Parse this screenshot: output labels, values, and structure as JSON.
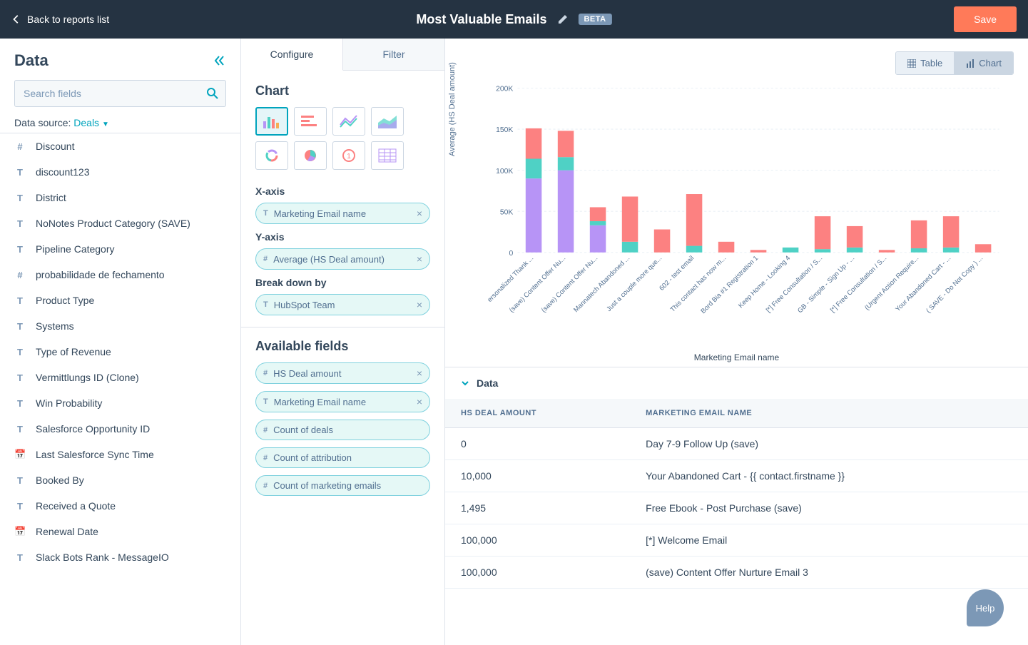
{
  "header": {
    "back_label": "Back to reports list",
    "title": "Most Valuable Emails",
    "badge": "BETA",
    "save_label": "Save"
  },
  "sidebar": {
    "title": "Data",
    "search_placeholder": "Search fields",
    "data_source_label": "Data source:",
    "data_source_value": "Deals",
    "fields": [
      {
        "type": "#",
        "label": "Discount"
      },
      {
        "type": "T",
        "label": "discount123"
      },
      {
        "type": "T",
        "label": "District"
      },
      {
        "type": "T",
        "label": "NoNotes Product Category (SAVE)"
      },
      {
        "type": "T",
        "label": "Pipeline Category"
      },
      {
        "type": "#",
        "label": "probabilidade de fechamento"
      },
      {
        "type": "T",
        "label": "Product Type"
      },
      {
        "type": "T",
        "label": "Systems"
      },
      {
        "type": "T",
        "label": "Type of Revenue"
      },
      {
        "type": "T",
        "label": "Vermittlungs ID (Clone)"
      },
      {
        "type": "T",
        "label": "Win Probability"
      },
      {
        "type": "T",
        "label": "Salesforce Opportunity ID"
      },
      {
        "type": "📅",
        "label": "Last Salesforce Sync Time"
      },
      {
        "type": "T",
        "label": "Booked By"
      },
      {
        "type": "T",
        "label": "Received a Quote"
      },
      {
        "type": "📅",
        "label": "Renewal Date"
      },
      {
        "type": "T",
        "label": "Slack Bots Rank - MessageIO"
      }
    ]
  },
  "config": {
    "tabs": [
      "Configure",
      "Filter"
    ],
    "active_tab": "Configure",
    "chart_section": "Chart",
    "xaxis_label": "X-axis",
    "yaxis_label": "Y-axis",
    "breakdown_label": "Break down by",
    "xaxis_pill": "Marketing Email name",
    "yaxis_pill": "Average (HS Deal amount)",
    "breakdown_pill": "HubSpot Team",
    "available_label": "Available fields",
    "available": [
      {
        "type": "#",
        "label": "HS Deal amount"
      },
      {
        "type": "T",
        "label": "Marketing Email name"
      },
      {
        "type": "#",
        "label": "Count of deals"
      },
      {
        "type": "#",
        "label": "Count of attribution"
      },
      {
        "type": "#",
        "label": "Count of marketing emails"
      }
    ]
  },
  "viz": {
    "table_btn": "Table",
    "chart_btn": "Chart",
    "active_view": "Chart",
    "yaxis_title": "Average (HS Deal amount)",
    "xaxis_title": "Marketing Email name",
    "data_section_title": "Data",
    "table_cols": [
      "HS DEAL AMOUNT",
      "MARKETING EMAIL NAME"
    ],
    "table_rows": [
      [
        "0",
        "Day 7-9 Follow Up (save)"
      ],
      [
        "10,000",
        "Your Abandoned Cart - {{ contact.firstname }}"
      ],
      [
        "1,495",
        "Free Ebook - Post Purchase (save)"
      ],
      [
        "100,000",
        "[*] Welcome Email"
      ],
      [
        "100,000",
        "(save) Content Offer Nurture Email 3"
      ]
    ]
  },
  "chart_data": {
    "type": "bar",
    "title": "",
    "xlabel": "Marketing Email name",
    "ylabel": "Average (HS Deal amount)",
    "ylim": [
      0,
      200000
    ],
    "yticks": [
      0,
      50000,
      100000,
      150000,
      200000
    ],
    "ytick_labels": [
      "0",
      "50K",
      "100K",
      "150K",
      "200K"
    ],
    "categories": [
      "[ST] Personalized Thank ...",
      "(save) Content Offer Nu...",
      "(save) Content Offer Nu...",
      "Mannatech Abandoned ...",
      "Just a couple more que...",
      "602 - test email",
      "This contact has now m...",
      "Bord Bia #1 Registration 1",
      "Keep Home - Looking 4",
      "[*] Free Consultation / S...",
      "GB - Simple - Sign Up - ...",
      "[*] Free Consultation / S...",
      "(Urgent Action Require...",
      "Your Abandoned Cart - ...",
      "( SAVE - Do Not Copy ) ..."
    ],
    "series": [
      {
        "name": "purple",
        "color": "#b794f6",
        "values": [
          90000,
          100000,
          33000,
          0,
          0,
          0,
          0,
          0,
          0,
          0,
          0,
          0,
          0,
          0,
          0
        ]
      },
      {
        "name": "teal",
        "color": "#4fd1c5",
        "values": [
          24000,
          16000,
          5000,
          13000,
          0,
          8000,
          0,
          0,
          6000,
          4000,
          6000,
          0,
          5000,
          6000,
          0
        ]
      },
      {
        "name": "coral",
        "color": "#fc8181",
        "values": [
          37000,
          32000,
          17000,
          55000,
          28000,
          63000,
          13000,
          3000,
          0,
          40000,
          26000,
          3000,
          34000,
          38000,
          10000
        ]
      }
    ]
  },
  "help_label": "Help"
}
